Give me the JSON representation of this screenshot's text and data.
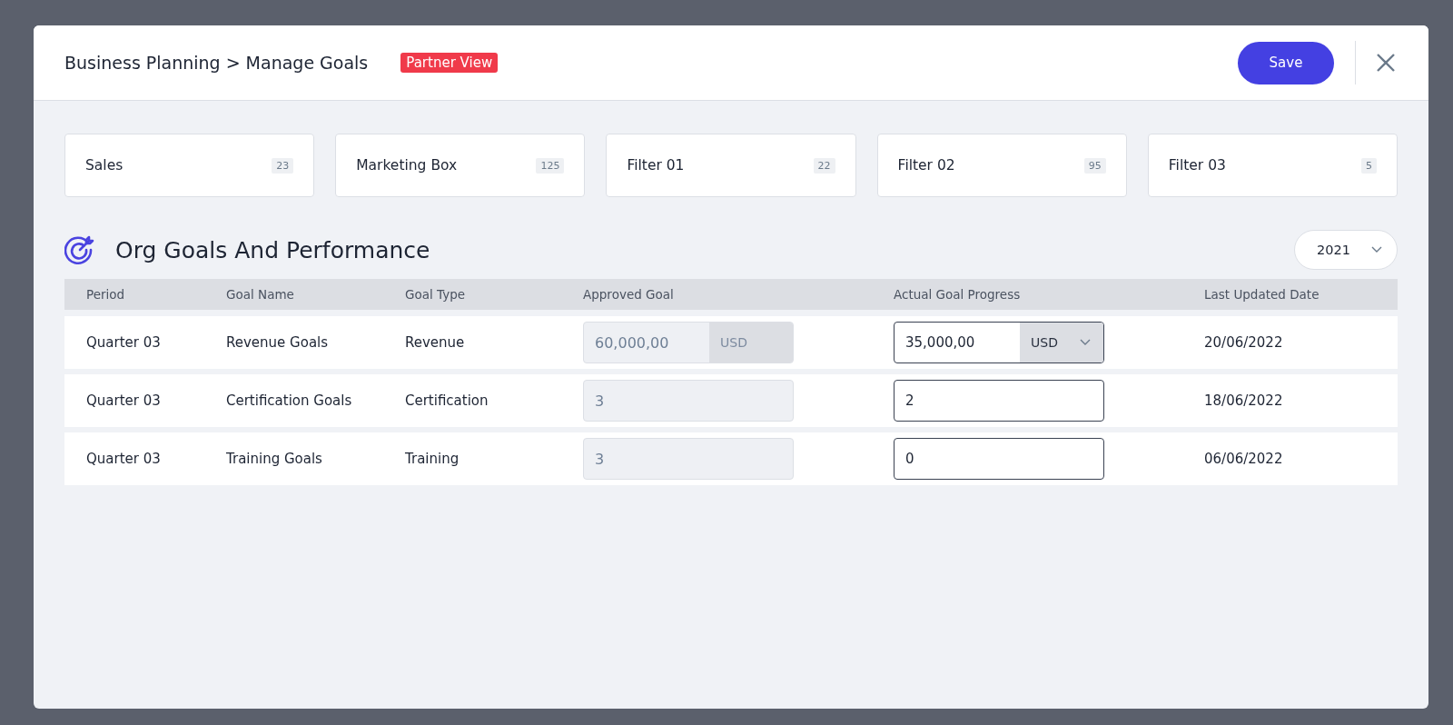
{
  "header": {
    "breadcrumb": [
      "Business Planning",
      "Manage Goals"
    ],
    "separator": ">",
    "badge": "Partner View",
    "save_button": "Save"
  },
  "filters": [
    {
      "label": "Sales",
      "count": "23"
    },
    {
      "label": "Marketing Box",
      "count": "125"
    },
    {
      "label": "Filter 01",
      "count": "22"
    },
    {
      "label": "Filter 02",
      "count": "95"
    },
    {
      "label": "Filter 03",
      "count": "5"
    }
  ],
  "section": {
    "title": "Org Goals And Performance",
    "year": "2021"
  },
  "table": {
    "columns": [
      "Period",
      "Goal Name",
      "Goal Type",
      "Approved Goal",
      "Actual Goal Progress",
      "Last Updated Date"
    ],
    "rows": [
      {
        "period": "Quarter 03",
        "goal_name": "Revenue Goals",
        "goal_type": "Revenue",
        "approved": {
          "value": "60,000,00",
          "currency": "USD"
        },
        "actual": {
          "value": "35,000,00",
          "currency": "USD"
        },
        "updated": "20/06/2022"
      },
      {
        "period": "Quarter 03",
        "goal_name": "Certification Goals",
        "goal_type": "Certification",
        "approved": {
          "value": "3"
        },
        "actual": {
          "value": "2"
        },
        "updated": "18/06/2022"
      },
      {
        "period": "Quarter 03",
        "goal_name": "Training Goals",
        "goal_type": "Training",
        "approved": {
          "value": "3"
        },
        "actual": {
          "value": "0"
        },
        "updated": "06/06/2022"
      }
    ]
  }
}
